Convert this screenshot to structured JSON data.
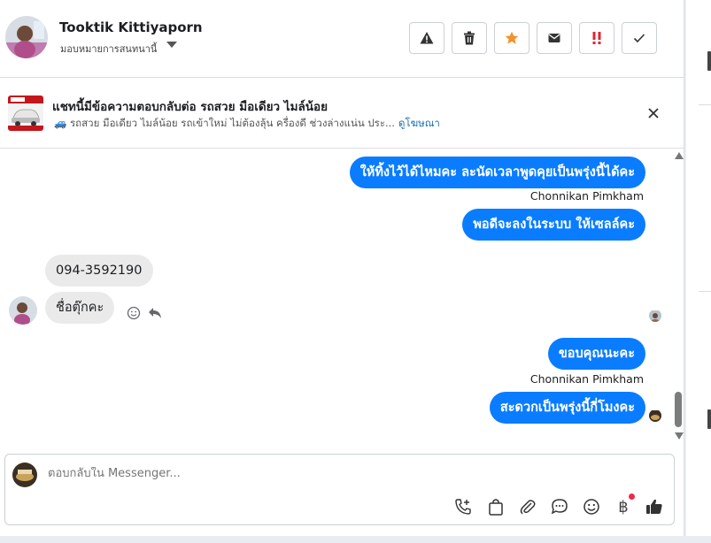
{
  "header": {
    "contact_name": "Tooktik Kittiyaporn",
    "assign_label": "มอบหมายการสนทนานี้",
    "actions": [
      {
        "icon": "warning-icon",
        "label": "Report"
      },
      {
        "icon": "trash-icon",
        "label": "Delete"
      },
      {
        "icon": "star-icon",
        "label": "Star",
        "color": "#f0932b"
      },
      {
        "icon": "envelope-icon",
        "label": "Mark unread"
      },
      {
        "icon": "important-icon",
        "label": "Important",
        "color": "#e0262f"
      },
      {
        "icon": "check-icon",
        "label": "Done"
      }
    ]
  },
  "ad_banner": {
    "title": "แชทนี้มีข้อความตอบกลับต่อ รถสวย มือเดียว ไมล์น้อย",
    "subtitle": "🚙 รถสวย มือเดียว ไมล์น้อย รถเข้าใหม่ ไม่ต้องลุ้น ครื่องดี ช่วงล่างแน่น ประ...",
    "link": "ดูโฆษณา"
  },
  "messages": {
    "out_1": "ให้ทิ้งไว้ได้ไหมคะ ละนัดเวลาพูดคุยเป็นพรุ่งนี้ได้คะ",
    "sender_1": "Chonnikan Pimkham",
    "out_2": "พอดีจะลงในระบบ ให้เซลล์คะ",
    "in_1": "094-3592190",
    "in_2": "ชื่อตุ๊กคะ",
    "out_3": "ขอบคุณนะคะ",
    "sender_2": "Chonnikan Pimkham",
    "out_4": "สะดวกเป็นพรุ่งนี้กี่โมงคะ"
  },
  "composer": {
    "placeholder": "ตอบกลับใน Messenger...",
    "tools": [
      "call-add-icon",
      "shopping-bag-icon",
      "paperclip-icon",
      "chat-bubble-icon",
      "emoji-icon",
      "baht-icon",
      "thumbs-up-icon"
    ],
    "baht_symbol": "฿"
  },
  "colors": {
    "outgoing_bubble": "#0a7cff",
    "incoming_bubble": "#eaeaea",
    "link": "#1a6fb3"
  }
}
